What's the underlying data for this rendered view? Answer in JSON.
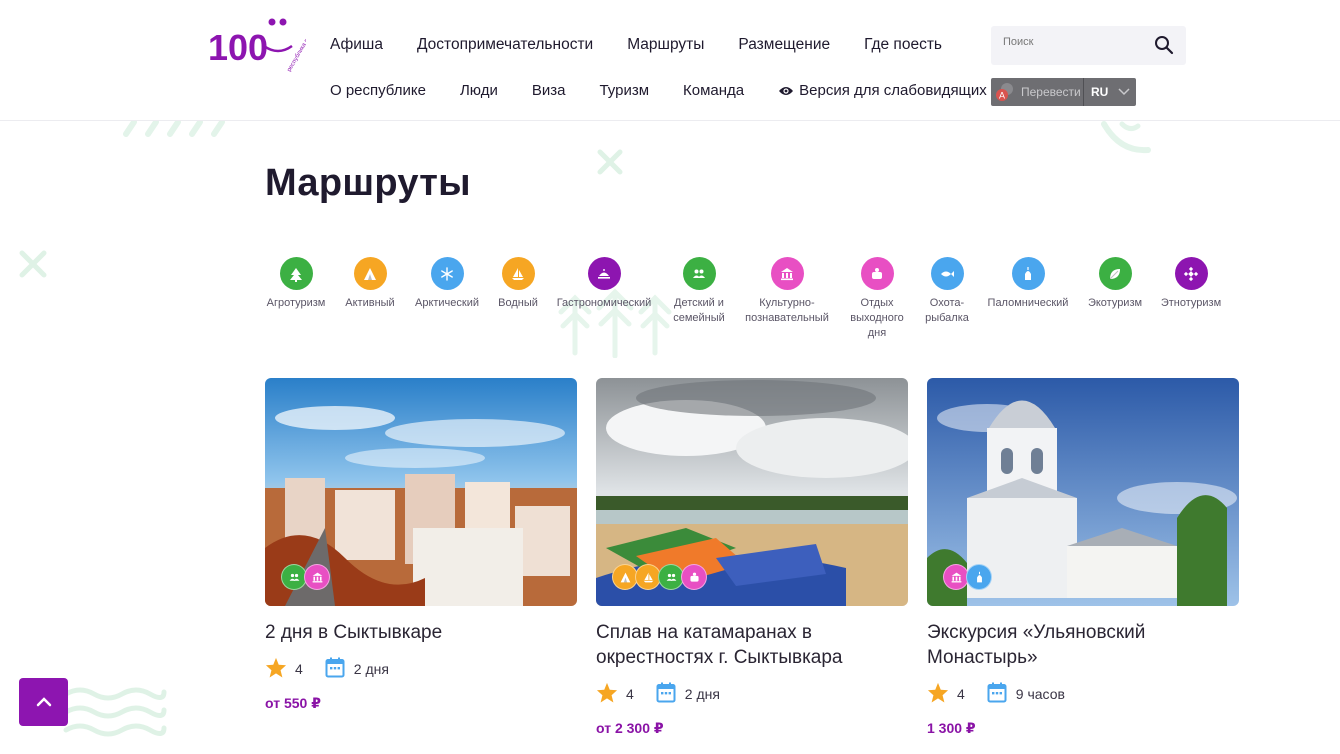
{
  "header": {
    "logo": {
      "numerals": "100",
      "caption": "республика коми"
    },
    "nav_row1": [
      "Афиша",
      "Достопримечательности",
      "Маршруты",
      "Размещение",
      "Где поесть"
    ],
    "nav_row2": [
      "О республике",
      "Люди",
      "Виза",
      "Туризм",
      "Команда"
    ],
    "accessibility_label": "Версия для слабовидящих",
    "search": {
      "placeholder": "Поиск",
      "icon": "search-icon"
    },
    "translate": {
      "label": "Перевести",
      "lang": "RU"
    }
  },
  "page_title": "Маршруты",
  "categories": [
    {
      "label": "Агротуризм",
      "color": "#3cb043",
      "icon": "tree-icon"
    },
    {
      "label": "Активный",
      "color": "#f6a623",
      "icon": "tent-icon"
    },
    {
      "label": "Арктический",
      "color": "#4aa6ee",
      "icon": "snowflake-icon"
    },
    {
      "label": "Водный",
      "color": "#f6a623",
      "icon": "sailboat-icon"
    },
    {
      "label": "Гастрономический",
      "color": "#8d15b0",
      "icon": "dish-icon"
    },
    {
      "label": "Детский и\nсемейный",
      "color": "#3cb043",
      "icon": "family-icon"
    },
    {
      "label": "Культурно-\nпознавательный",
      "color": "#e84fc3",
      "icon": "museum-icon"
    },
    {
      "label": "Отдых\nвыходного\nдня",
      "color": "#e84fc3",
      "icon": "weekend-icon"
    },
    {
      "label": "Охота-\nрыбалка",
      "color": "#4aa6ee",
      "icon": "fishing-icon"
    },
    {
      "label": "Паломнический",
      "color": "#4aa6ee",
      "icon": "church-icon"
    },
    {
      "label": "Экотуризм",
      "color": "#3cb043",
      "icon": "leaf-icon"
    },
    {
      "label": "Этнотуризм",
      "color": "#8d15b0",
      "icon": "ornament-icon"
    }
  ],
  "cards": [
    {
      "title": "2 дня в Сыктывкаре",
      "rating": "4",
      "duration": "2 дня",
      "price": "от 550 ₽",
      "badges": [
        {
          "color": "#3cb043",
          "icon": "family-icon"
        },
        {
          "color": "#e84fc3",
          "icon": "museum-icon"
        }
      ]
    },
    {
      "title": "Сплав на катамаранах в окрестностях г. Сыктывкара",
      "rating": "4",
      "duration": "2 дня",
      "price": "от 2 300 ₽",
      "badges": [
        {
          "color": "#f6a623",
          "icon": "tent-icon"
        },
        {
          "color": "#f6a623",
          "icon": "sailboat-icon"
        },
        {
          "color": "#3cb043",
          "icon": "family-icon"
        },
        {
          "color": "#e84fc3",
          "icon": "weekend-icon"
        }
      ]
    },
    {
      "title": "Экскурсия «Ульяновский Монастырь»",
      "rating": "4",
      "duration": "9 часов",
      "price": "1 300 ₽",
      "badges": [
        {
          "color": "#e84fc3",
          "icon": "museum-icon"
        },
        {
          "color": "#4aa6ee",
          "icon": "church-icon"
        }
      ]
    }
  ],
  "colors": {
    "brand": "#8d15b0",
    "star": "#f6a623",
    "calendar": "#4aa6ee",
    "deco": "#dff2e6"
  }
}
